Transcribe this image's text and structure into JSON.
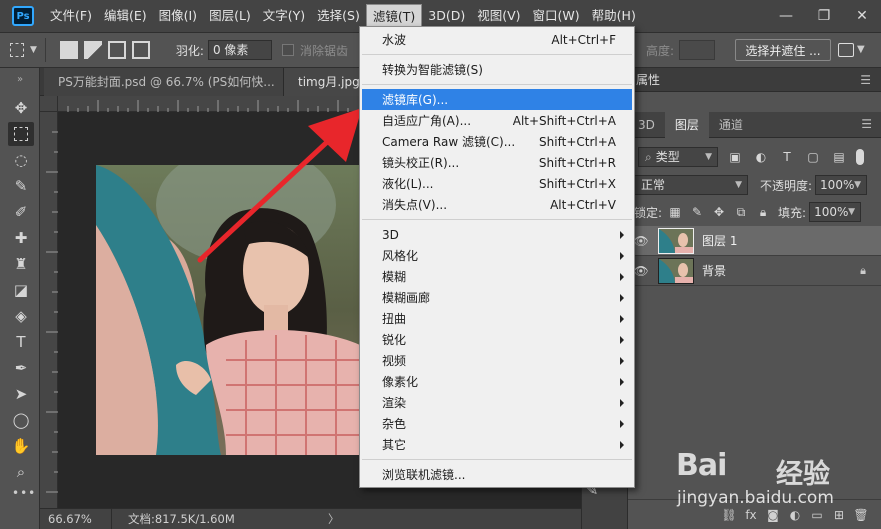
{
  "app": {
    "logo": "Ps"
  },
  "menubar": {
    "items": [
      "文件(F)",
      "编辑(E)",
      "图像(I)",
      "图层(L)",
      "文字(Y)",
      "选择(S)",
      "滤镜(T)",
      "3D(D)",
      "视图(V)",
      "窗口(W)",
      "帮助(H)"
    ],
    "active_index": 6,
    "window_controls": [
      "—",
      "❐",
      "✕"
    ]
  },
  "options": {
    "feather_label": "羽化:",
    "feather_value": "0 像素",
    "antialias_label": "消除锯齿",
    "height_label": "高度:",
    "select_mask_label": "选择并遮住 ..."
  },
  "tabs": [
    {
      "label": "PS万能封面.psd @ 66.7% (PS如何快...",
      "close": "×"
    },
    {
      "label": "timg月.jpg @",
      "close": "×"
    }
  ],
  "status": {
    "zoom": "66.67%",
    "doc": "文档:817.5K/1.60M",
    "arrow": "〉"
  },
  "filter_menu": {
    "items": [
      {
        "label": "水波",
        "shortcut": "Alt+Ctrl+F",
        "submenu": false
      },
      {
        "label": "转换为智能滤镜(S)",
        "shortcut": "",
        "submenu": false
      },
      {
        "label": "滤镜库(G)...",
        "shortcut": "",
        "submenu": false,
        "highlighted": true
      },
      {
        "label": "自适应广角(A)...",
        "shortcut": "Alt+Shift+Ctrl+A",
        "submenu": false
      },
      {
        "label": "Camera Raw 滤镜(C)...",
        "shortcut": "Shift+Ctrl+A",
        "submenu": false
      },
      {
        "label": "镜头校正(R)...",
        "shortcut": "Shift+Ctrl+R",
        "submenu": false
      },
      {
        "label": "液化(L)...",
        "shortcut": "Shift+Ctrl+X",
        "submenu": false
      },
      {
        "label": "消失点(V)...",
        "shortcut": "Alt+Ctrl+V",
        "submenu": false
      },
      {
        "label": "3D",
        "shortcut": "",
        "submenu": true
      },
      {
        "label": "风格化",
        "shortcut": "",
        "submenu": true
      },
      {
        "label": "模糊",
        "shortcut": "",
        "submenu": true
      },
      {
        "label": "模糊画廊",
        "shortcut": "",
        "submenu": true
      },
      {
        "label": "扭曲",
        "shortcut": "",
        "submenu": true
      },
      {
        "label": "锐化",
        "shortcut": "",
        "submenu": true
      },
      {
        "label": "视频",
        "shortcut": "",
        "submenu": true
      },
      {
        "label": "像素化",
        "shortcut": "",
        "submenu": true
      },
      {
        "label": "渲染",
        "shortcut": "",
        "submenu": true
      },
      {
        "label": "杂色",
        "shortcut": "",
        "submenu": true
      },
      {
        "label": "其它",
        "shortcut": "",
        "submenu": true
      },
      {
        "label": "浏览联机滤镜...",
        "shortcut": "",
        "submenu": false
      }
    ]
  },
  "panel": {
    "properties_title": "属性",
    "tabs": [
      "3D",
      "图层",
      "通道"
    ],
    "active_tab": 1,
    "filter_kind": "类型",
    "blend_mode": "正常",
    "opacity_label": "不透明度:",
    "opacity_value": "100%",
    "lock_label": "锁定:",
    "fill_label": "填充:",
    "fill_value": "100%",
    "layers": [
      {
        "name": "图层 1",
        "selected": true,
        "locked": false
      },
      {
        "name": "背景",
        "selected": false,
        "locked": true
      }
    ],
    "footer_icons": [
      "link-icon",
      "fx-icon",
      "mask-add-icon",
      "adjustment-icon",
      "folder-icon",
      "new-layer-icon",
      "trash-icon"
    ]
  },
  "colors": {
    "menu_highlight": "#2f82e6",
    "ps_blue": "#31a8ff",
    "arrow_red": "#e8262b"
  },
  "watermark": {
    "brand": "Bai",
    "cn": "经验",
    "url": "jingyan.baidu.com"
  }
}
